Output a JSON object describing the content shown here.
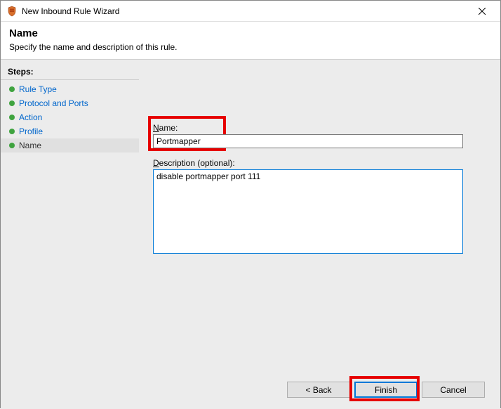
{
  "window": {
    "title": "New Inbound Rule Wizard"
  },
  "header": {
    "title": "Name",
    "subtitle": "Specify the name and description of this rule."
  },
  "sidebar": {
    "label": "Steps:",
    "items": [
      {
        "label": "Rule Type"
      },
      {
        "label": "Protocol and Ports"
      },
      {
        "label": "Action"
      },
      {
        "label": "Profile"
      },
      {
        "label": "Name"
      }
    ]
  },
  "form": {
    "name_label_prefix": "N",
    "name_label_rest": "ame:",
    "name_value": "Portmapper",
    "desc_label_prefix": "D",
    "desc_label_rest": "escription (optional):",
    "desc_value": "disable portmapper port 111"
  },
  "buttons": {
    "back": "< Back",
    "finish": "Finish",
    "cancel": "Cancel"
  }
}
